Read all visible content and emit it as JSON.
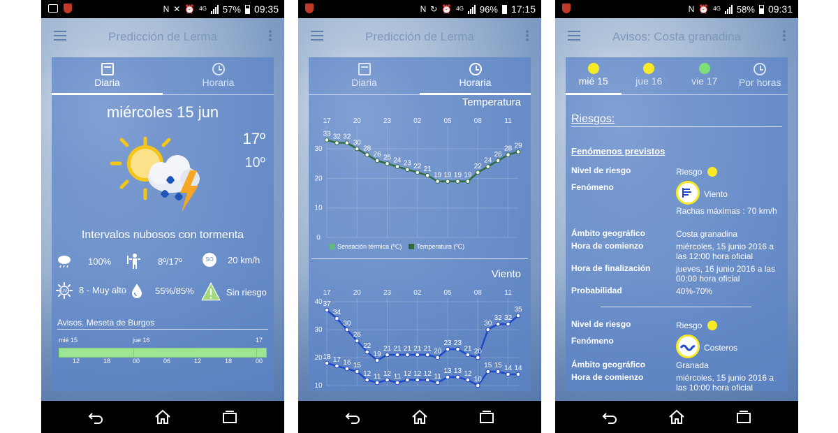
{
  "colors": {
    "panel": "#5c84c8",
    "warning_yellow": "#f8ea27",
    "warning_green": "#7ee07a",
    "timeline_green": "#9ee495",
    "series_blue": "#1f49c7",
    "series_green": "#2f6b3e",
    "title_grey": "#7d97bb"
  },
  "phone1": {
    "status": {
      "battery": "57%",
      "time": "09:35",
      "net": "4G"
    },
    "title": "Predicción de Lerma",
    "tabs": [
      {
        "label": "Diaria",
        "icon": "calendar-icon"
      },
      {
        "label": "Horaria",
        "icon": "clock-icon"
      }
    ],
    "date": "miércoles 15 jun",
    "temp_max": "17º",
    "temp_min": "10º",
    "description": "Intervalos nubosos con tormenta",
    "stats": {
      "rain_prob": "100%",
      "temperature_range": "8º/17º",
      "wind_dir": "SO",
      "wind_speed": "20 km/h",
      "uv": "8 - Muy alto",
      "uv_icon": "UV",
      "humidity": "55%/85%",
      "risk": "Sin riesgo"
    },
    "warnings_title": "Avisos. Meseta de Burgos",
    "timeline": {
      "days": [
        "mié 15",
        "jue 16",
        "17"
      ],
      "ticks": [
        "12",
        "18",
        "00",
        "06",
        "12",
        "18",
        "00"
      ]
    }
  },
  "phone2": {
    "status": {
      "battery": "96%",
      "time": "17:15",
      "net": "4G"
    },
    "title": "Predicción de Lerma",
    "tabs": [
      {
        "label": "Diaria",
        "icon": "calendar-icon"
      },
      {
        "label": "Horaria",
        "icon": "clock-icon"
      }
    ],
    "chart_data": [
      {
        "type": "line",
        "title": "Temperatura",
        "x_labels": [
          "17",
          "20",
          "23",
          "02",
          "05",
          "08",
          "11"
        ],
        "ylim": [
          0,
          35
        ],
        "y_ticks": [
          "0",
          "10",
          "20",
          "30"
        ],
        "series": [
          {
            "name": "Sensación térmica (ºC)",
            "color": "#5fb97a",
            "values": [
              33,
              32,
              32,
              30,
              28,
              26,
              25,
              24,
              23,
              22,
              21,
              19,
              19,
              19,
              19,
              22,
              24,
              26,
              28,
              29
            ]
          },
          {
            "name": "Temperatura (ºC)",
            "color": "#2f6b3e",
            "values": [
              33,
              32,
              32,
              30,
              28,
              26,
              25,
              24,
              23,
              22,
              21,
              19,
              19,
              19,
              19,
              22,
              24,
              26,
              28,
              29
            ]
          }
        ],
        "point_labels": [
          "33",
          "32",
          "32",
          "30",
          "28",
          "26",
          "25",
          "24",
          "23",
          "22",
          "21",
          "19",
          "19",
          "19",
          "19",
          "22",
          "24",
          "26",
          "28",
          "29"
        ]
      },
      {
        "type": "line",
        "title": "Viento",
        "x_labels": [
          "17",
          "20",
          "23",
          "02",
          "05",
          "08",
          "11"
        ],
        "ylim": [
          10,
          40
        ],
        "y_ticks": [
          "10",
          "20",
          "30",
          "40"
        ],
        "series": [
          {
            "name": "racha",
            "color": "#1f49c7",
            "values": [
              37,
              34,
              30,
              26,
              22,
              19,
              21,
              21,
              21,
              21,
              21,
              20,
              23,
              23,
              21,
              20,
              30,
              32,
              32,
              35
            ]
          },
          {
            "name": "media",
            "color": "#1f49c7",
            "values": [
              18,
              17,
              16,
              15,
              12,
              11,
              12,
              11,
              12,
              12,
              12,
              11,
              13,
              13,
              12,
              10,
              15,
              15,
              14,
              14
            ]
          }
        ],
        "point_labels_top": [
          "37",
          "34",
          "30",
          "26",
          "22",
          "19",
          "21",
          "21",
          "21",
          "21",
          "21",
          "20",
          "23",
          "23",
          "21",
          "20",
          "30",
          "32",
          "32",
          "35"
        ],
        "point_labels_bottom": [
          "18",
          "17",
          "16",
          "15",
          "12",
          "11",
          "12",
          "11",
          "12",
          "12",
          "12",
          "11",
          "13",
          "13",
          "12",
          "10",
          "15",
          "15",
          "14",
          "14"
        ]
      }
    ]
  },
  "phone3": {
    "status": {
      "battery": "58%",
      "time": "09:31",
      "net": "4G"
    },
    "title": "Avisos: Costa granadina",
    "tabs": [
      {
        "label": "mié 15",
        "color": "#f8ea27"
      },
      {
        "label": "jue 16",
        "color": "#f8ea27"
      },
      {
        "label": "vie 17",
        "color": "#7ee07a"
      },
      {
        "label": "Por horas",
        "icon": "clock-icon"
      }
    ],
    "heading": "Riesgos:",
    "subheading": "Fenómenos previstos",
    "warnings": [
      {
        "nivel_label": "Nivel de riesgo",
        "nivel_value": "Riesgo",
        "fenomeno_label": "Fenómeno",
        "fenomeno_value": "Viento",
        "extra": "Rachas máximas : 70 km/h",
        "ambito_label": "Ámbito geográfico",
        "ambito_value": "Costa granadina",
        "inicio_label": "Hora de comienzo",
        "inicio_value": "miércoles, 15 junio 2016 a las 12:00 hora oficial",
        "fin_label": "Hora de finalización",
        "fin_value": "jueves, 16 junio 2016 a las 00:00 hora oficial",
        "prob_label": "Probabilidad",
        "prob_value": "40%-70%"
      },
      {
        "nivel_label": "Nivel de riesgo",
        "nivel_value": "Riesgo",
        "fenomeno_label": "Fenómeno",
        "fenomeno_value": "Costeros",
        "ambito_label": "Ámbito geográfico",
        "ambito_value": "Granada",
        "inicio_label": "Hora de comienzo",
        "inicio_value": "miércoles, 15 junio 2016 a las 10:00 hora oficial"
      }
    ]
  }
}
